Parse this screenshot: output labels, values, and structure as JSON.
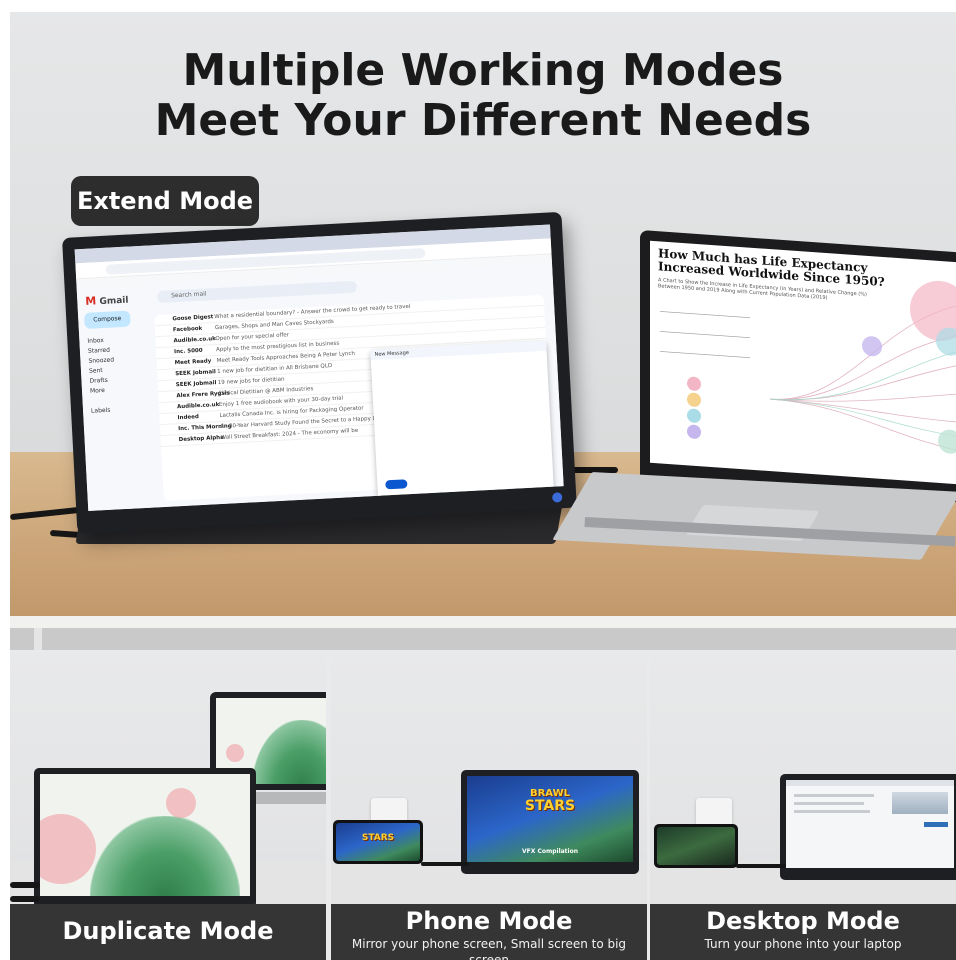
{
  "hero": {
    "headline_line1": "Multiple Working Modes",
    "headline_line2": "Meet Your Different Needs",
    "mode_label": "Extend Mode"
  },
  "monitor_screen": {
    "app_name": "Gmail",
    "compose_label": "Compose",
    "search_placeholder": "Search mail",
    "nav": [
      "Inbox",
      "Starred",
      "Snoozed",
      "Sent",
      "Drafts",
      "More"
    ],
    "labels_heading": "Labels",
    "new_message_title": "New Message",
    "emails": [
      {
        "sender": "Goose Digest",
        "subject": "What a residential boundary? - Answer the crowd to get ready to travel"
      },
      {
        "sender": "Facebook",
        "subject": "Garages, Shops and Man Caves Stockyards"
      },
      {
        "sender": "Audible.co.uk",
        "subject": "Open for your special offer"
      },
      {
        "sender": "Inc. 5000",
        "subject": "Apply to the most prestigious list in business"
      },
      {
        "sender": "Meet Ready",
        "subject": "Meet Ready Tools Approaches Being A Peter Lynch"
      },
      {
        "sender": "SEEK Jobmail",
        "subject": "1 new job for dietitian in All Brisbane QLD"
      },
      {
        "sender": "SEEK Jobmail",
        "subject": "19 new jobs for dietitian"
      },
      {
        "sender": "Alex Frere Rygsis",
        "subject": "Clinical Dietitian @ ABM Industries"
      },
      {
        "sender": "Audible.co.uk",
        "subject": "Enjoy 1 free audiobook with your 30-day trial"
      },
      {
        "sender": "Indeed",
        "subject": "Lactalis Canada Inc. is hiring for Packaging Operator"
      },
      {
        "sender": "Inc. This Morning",
        "subject": "An 80-Year Harvard Study Found the Secret to a Happy Life"
      },
      {
        "sender": "Desktop Alpha",
        "subject": "Wall Street Breakfast: 2024 - The economy will be"
      }
    ]
  },
  "laptop_screen": {
    "title": "How Much has Life Expectancy Increased Worldwide Since 1950?",
    "subtitle": "A Chart to Show the Increase in Life Expectancy (in Years) and Relative Change (%) Between 1950 and 2019 Along with Current Population Data (2019)"
  },
  "panels": [
    {
      "title": "Duplicate Mode",
      "subtitle": ""
    },
    {
      "title": "Phone Mode",
      "subtitle": "Mirror your phone screen, Small screen to big screen"
    },
    {
      "title": "Desktop Mode",
      "subtitle": "Turn your phone into your laptop"
    }
  ],
  "game_screen": {
    "game_title_line1": "BRAWL",
    "game_title_line2": "STARS",
    "caption": "VFX Compilation"
  },
  "colors": {
    "badge_bg": "#2d2d2d",
    "caption_bg": "#353535",
    "desk_wood": "#caa377",
    "gmail_compose": "#c2e7ff",
    "gmail_send": "#0b57d0"
  }
}
